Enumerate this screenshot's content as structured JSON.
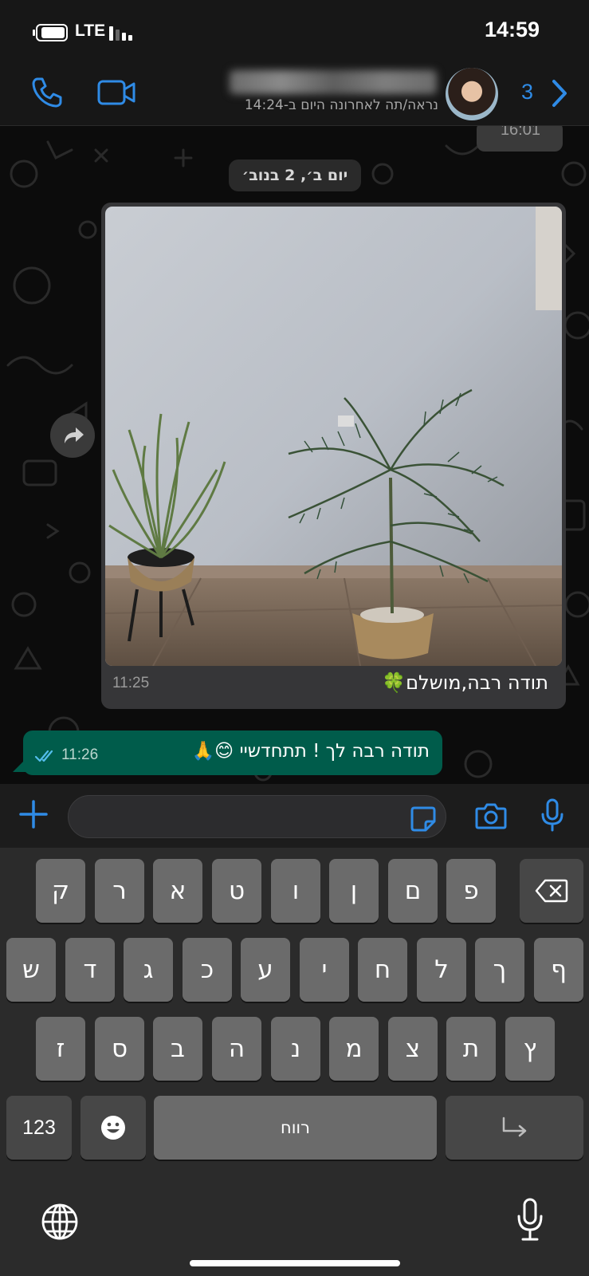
{
  "status_bar": {
    "network": "LTE",
    "time": "14:59"
  },
  "header": {
    "last_seen": "נראה/תה לאחרונה היום ב-14:24",
    "back_count": "3"
  },
  "chat": {
    "previous_time": "16:01",
    "date_label": "יום ב׳, 2 בנוב׳",
    "incoming": {
      "caption": "תודה רבה,מושלם🍀",
      "time": "11:25"
    },
    "outgoing": {
      "text": "תודה רבה לך ! תתחדשיי 😊🙏",
      "time": "11:26"
    }
  },
  "keyboard": {
    "row1": [
      "ק",
      "ר",
      "א",
      "ט",
      "ו",
      "ן",
      "ם",
      "פ"
    ],
    "row2": [
      "ש",
      "ד",
      "ג",
      "כ",
      "ע",
      "י",
      "ח",
      "ל",
      "ך",
      "ף"
    ],
    "row3": [
      "ז",
      "ס",
      "ב",
      "ה",
      "נ",
      "מ",
      "צ",
      "ת",
      "ץ"
    ],
    "numbers_key": "123",
    "space_label": "רווח"
  },
  "colors": {
    "accent": "#2f8be6",
    "outgoing_bubble": "#005c4b",
    "incoming_bubble": "#363638"
  }
}
